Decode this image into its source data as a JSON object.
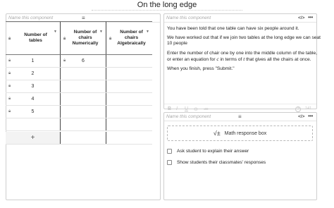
{
  "page": {
    "title": "On the long edge"
  },
  "left_panel": {
    "name_placeholder": "Name this component",
    "menu_icon": "hamburger-icon",
    "code_label": "</>",
    "more_label": "•••",
    "table": {
      "headers": [
        "Number of tables",
        "Number of chairs Numerically",
        "Number of chairs Algebraically"
      ],
      "rows": [
        [
          "1",
          "6",
          ""
        ],
        [
          "2",
          "",
          ""
        ],
        [
          "3",
          "",
          ""
        ],
        [
          "4",
          "",
          ""
        ],
        [
          "5",
          "",
          ""
        ],
        [
          "",
          "",
          ""
        ]
      ],
      "add_label": "+"
    }
  },
  "text_panel": {
    "name_placeholder": "Name this component",
    "code_label": "</>",
    "more_label": "•••",
    "paragraphs": {
      "p1": "You have been told that one table can have six people around it.",
      "p2": "We have worked out that if we join two tables at the long edge we can seat 10 people",
      "p3_a": "Enter the number of chair one by one into the middle column of the table, or enter an equation for ",
      "p3_var1": "c",
      "p3_b": " in terms of ",
      "p3_var2": "t",
      "p3_c": " that gives all the chairs at once.",
      "p4": "When you finish, press \"Submit.\""
    },
    "toolbar": {
      "bold": "B",
      "italic": "I",
      "underline": "U",
      "link": "⊖",
      "list": "≔",
      "help": "?",
      "count": "141"
    }
  },
  "math_panel": {
    "name_placeholder": "Name this component",
    "code_label": "</>",
    "more_label": "•••",
    "math_symbol": "√±",
    "math_label": "Math response box",
    "options": [
      {
        "label": "Ask student to explain their answer",
        "checked": false
      },
      {
        "label": "Show students their classmates' responses",
        "checked": false
      }
    ]
  }
}
